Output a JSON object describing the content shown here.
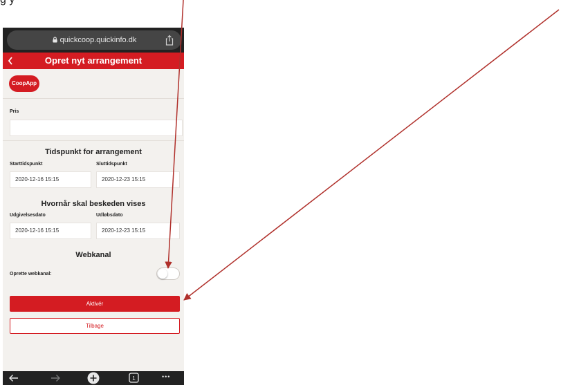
{
  "page": {
    "cut_text": "g                                                                                              y"
  },
  "browser": {
    "url": "quickcoop.quickinfo.dk"
  },
  "header": {
    "title": "Opret nyt arrangement"
  },
  "app_pill": {
    "label": "CoopApp"
  },
  "price": {
    "label": "Pris",
    "value": ""
  },
  "event_time": {
    "title": "Tidspunkt for arrangement",
    "start_label": "Starttidspunkt",
    "start_value": "2020-12-16 15:15",
    "end_label": "Sluttidspunkt",
    "end_value": "2020-12-23 15:15"
  },
  "message_time": {
    "title": "Hvornår skal beskeden vises",
    "publish_label": "Udgivelsesdato",
    "publish_value": "2020-12-16 15:15",
    "expiry_label": "Udløbsdato",
    "expiry_value": "2020-12-23 15:15"
  },
  "webchannel": {
    "title": "Webkanal",
    "create_label": "Oprette webkanal:",
    "toggle_state": "off"
  },
  "buttons": {
    "activate": "Aktivér",
    "back": "Tilbage"
  },
  "bottom_bar": {
    "tab_count": "1",
    "more": "•••"
  },
  "colors": {
    "brand_red": "#d41c22",
    "arrow_red": "#b0302b",
    "background": "#f3f1ee"
  }
}
